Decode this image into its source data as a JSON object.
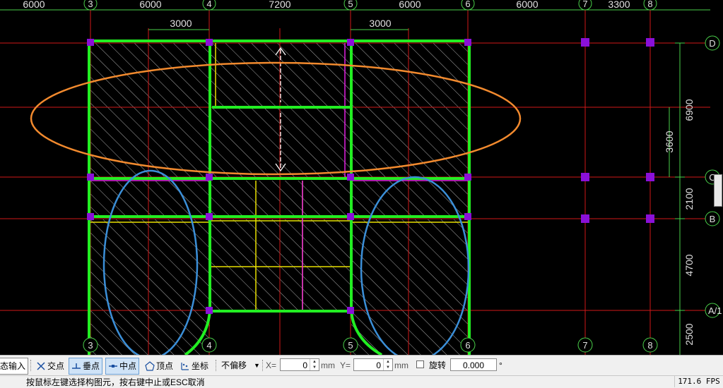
{
  "axes": {
    "top_dims": [
      "6000",
      "6000",
      "7200",
      "6000",
      "6000",
      "3300"
    ],
    "sub_dims": [
      "3000",
      "3000"
    ],
    "col_labels": [
      "3",
      "4",
      "5",
      "6",
      "7",
      "8"
    ],
    "row_labels": [
      "D",
      "C",
      "B",
      "A/1"
    ],
    "right_dims": [
      "6900",
      "3600",
      "2100",
      "4700",
      "2500"
    ]
  },
  "toolbar": {
    "dynamic_input": "态输入",
    "snap_intersection": "交点",
    "snap_perpendicular": "垂点",
    "snap_midpoint": "中点",
    "snap_vertex": "顶点",
    "snap_coordinate": "坐标",
    "offset_mode": "不偏移",
    "x_label": "X=",
    "x_value": "0",
    "x_unit": "mm",
    "y_label": "Y=",
    "y_value": "0",
    "y_unit": "mm",
    "rotate_label": "旋转",
    "rotate_value": "0.000",
    "degree": "°"
  },
  "status": {
    "message": "按鼠标左键选择构图元，按右键中止或ESC取消",
    "fps": "171.6 FPS"
  }
}
